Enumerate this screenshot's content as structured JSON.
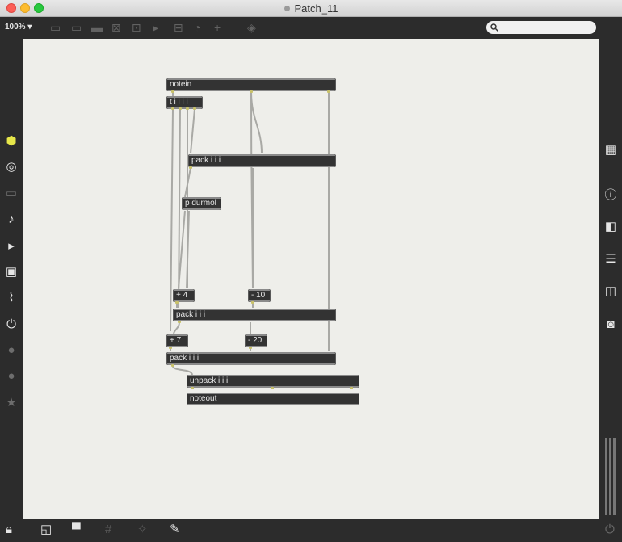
{
  "window": {
    "title": "Patch_11"
  },
  "toolbar": {
    "zoom": "100%"
  },
  "patch": {
    "objects": {
      "notein": "notein",
      "trigger": "t i i i i",
      "pack1": "pack i i i",
      "durmol": "p durmol",
      "plus4": "+ 4",
      "minus10": "- 10",
      "pack2": "pack i i i",
      "plus7": "+ 7",
      "minus20": "- 20",
      "pack3": "pack i i i",
      "unpack": "unpack i i i",
      "noteout": "noteout"
    }
  },
  "colors": {
    "canvas": "#eeeeea",
    "object_fill": "#333333",
    "cord": "#a9a9a5",
    "port": "#c8c16a",
    "accent_yellow": "#e7e74a"
  },
  "icons": {
    "left_sidebar": [
      "cube-icon",
      "circle-target-icon",
      "keyboard-icon",
      "music-note-icon",
      "play-marker-icon",
      "image-icon",
      "paperclip-icon",
      "plug-icon",
      "v-logo-icon",
      "b-logo-icon",
      "star-icon"
    ],
    "right_sidebar": [
      "grid-icon",
      "info-icon",
      "book-icon",
      "list-icon",
      "book-open-icon",
      "camera-icon"
    ],
    "bottom_bar": [
      "lock-icon",
      "windows-icon",
      "presentation-icon",
      "grid-icon",
      "magic-wand-icon",
      "wrench-icon",
      "power-icon"
    ]
  }
}
